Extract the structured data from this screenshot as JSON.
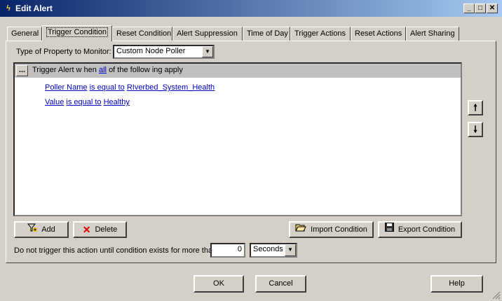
{
  "window": {
    "title": "Edit Alert",
    "title_icon": "lightning-icon",
    "controls": [
      "minimize",
      "maximize",
      "close"
    ]
  },
  "tabs": [
    {
      "label": "General",
      "active": false
    },
    {
      "label": "Trigger Condition",
      "active": true
    },
    {
      "label": "Reset Condition",
      "active": false
    },
    {
      "label": "Alert Suppression",
      "active": false
    },
    {
      "label": "Time of Day",
      "active": false
    },
    {
      "label": "Trigger Actions",
      "active": false
    },
    {
      "label": "Reset Actions",
      "active": false
    },
    {
      "label": "Alert Sharing",
      "active": false
    }
  ],
  "property": {
    "label": "Type of Property to Monitor:",
    "value": "Custom Node Poller"
  },
  "condition": {
    "header_prefix": "Trigger Alert w hen",
    "header_link": "all",
    "header_suffix": "of the follow ing apply",
    "dots_label": "...",
    "rows": [
      {
        "field": "Poller Name",
        "op": "is equal to",
        "value": "RIverbed_System_Health"
      },
      {
        "field": "Value",
        "op": "is equal to",
        "value": "Healthy"
      }
    ]
  },
  "buttons": {
    "add": "Add",
    "delete": "Delete",
    "import": "Import Condition",
    "export": "Export Condition",
    "ok": "OK",
    "cancel": "Cancel",
    "help": "Help"
  },
  "delay": {
    "label": "Do not trigger this action until condition exists for more than",
    "value": "0",
    "unit": "Seconds"
  },
  "colors": {
    "title_start": "#0a246a",
    "title_end": "#a6caf0",
    "link": "#0000cc",
    "face": "#d4d0c8"
  }
}
